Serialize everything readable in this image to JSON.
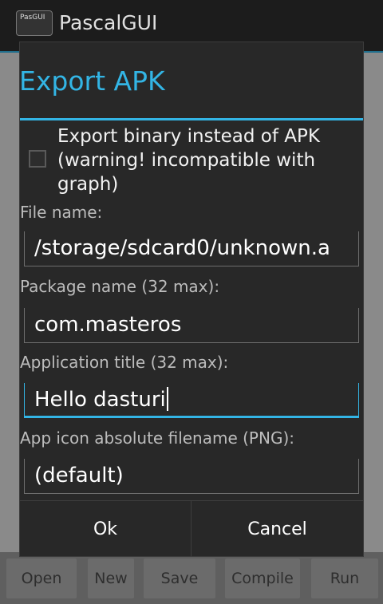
{
  "app": {
    "icon_text": "PasGUI",
    "title": "PascalGUI"
  },
  "bottom_bar": {
    "buttons": [
      {
        "label": "Open"
      },
      {
        "label": "New"
      },
      {
        "label": "Save"
      },
      {
        "label": "Compile"
      },
      {
        "label": "Run"
      }
    ]
  },
  "dialog": {
    "title": "Export APK",
    "checkbox": {
      "label": "Export binary instead of APK (warning! incompatible with graph)",
      "checked": false
    },
    "fields": [
      {
        "label": "File name:",
        "value": "/storage/sdcard0/unknown.a"
      },
      {
        "label": "Package name (32 max):",
        "value": "com.masteros"
      },
      {
        "label": "Application title (32 max):",
        "value": "Hello dasturi"
      },
      {
        "label": "App icon absolute filename (PNG):",
        "value": "(default)"
      }
    ],
    "ok_label": "Ok",
    "cancel_label": "Cancel"
  },
  "colors": {
    "accent": "#33b5e5",
    "dialog_bg": "#282828"
  }
}
